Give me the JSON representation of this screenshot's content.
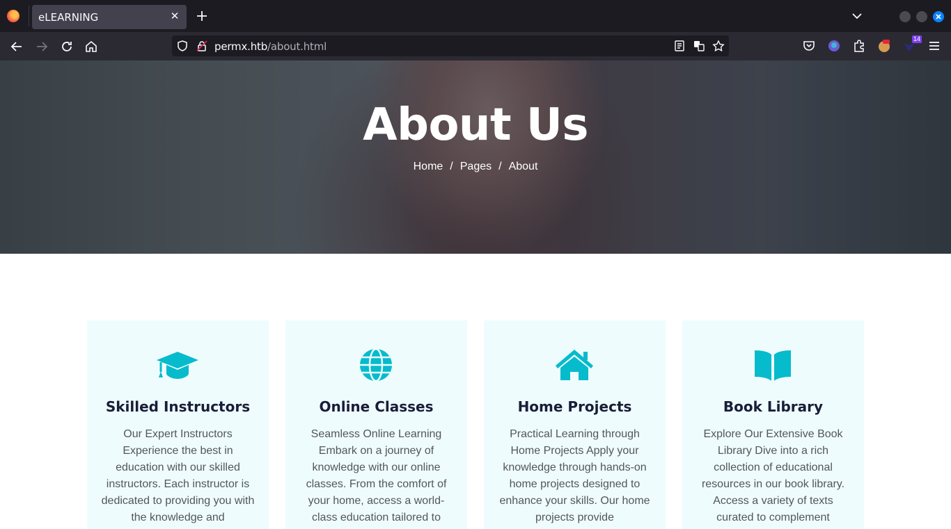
{
  "browser": {
    "tab_title": "eLEARNING",
    "url_host": "permx.htb",
    "url_path": "/about.html",
    "extension_badge": "14"
  },
  "hero": {
    "title": "About Us",
    "breadcrumb": [
      "Home",
      "Pages",
      "About"
    ],
    "separator": "/"
  },
  "features": [
    {
      "icon": "graduation-cap-icon",
      "title": "Skilled Instructors",
      "text": "Our Expert Instructors Experience the best in education with our skilled instructors. Each instructor is dedicated to providing you with the knowledge and"
    },
    {
      "icon": "globe-icon",
      "title": "Online Classes",
      "text": "Seamless Online Learning Embark on a journey of knowledge with our online classes. From the comfort of your home, access a world-class education tailored to"
    },
    {
      "icon": "home-icon",
      "title": "Home Projects",
      "text": "Practical Learning through Home Projects Apply your knowledge through hands-on home projects designed to enhance your skills. Our home projects provide"
    },
    {
      "icon": "book-open-icon",
      "title": "Book Library",
      "text": "Explore Our Extensive Book Library Dive into a rich collection of educational resources in our book library. Access a variety of texts curated to complement"
    }
  ],
  "colors": {
    "accent": "#06bbcc",
    "card_bg": "#effcfd",
    "heading": "#181d38"
  }
}
